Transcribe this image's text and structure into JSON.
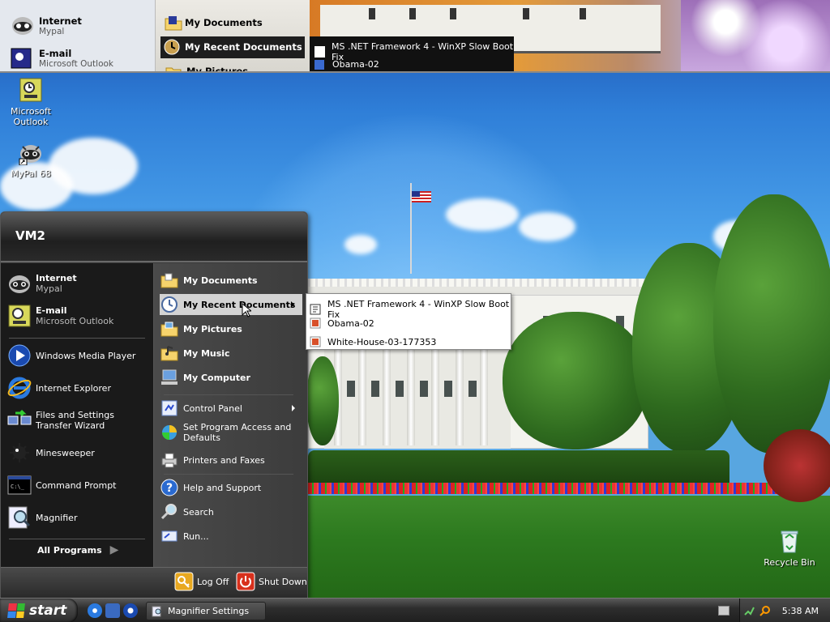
{
  "top_strip": {
    "left": {
      "internet_title": "Internet",
      "internet_sub": "Mypal",
      "email_title": "E-mail",
      "email_sub": "Microsoft Outlook"
    },
    "right": {
      "my_documents": "My Documents",
      "my_recent_documents": "My Recent Documents",
      "my_pictures": "My Pictures"
    },
    "popup": {
      "items": [
        "MS .NET Framework 4 - WinXP Slow Boot Fix",
        "Obama-02"
      ]
    }
  },
  "desktop": {
    "icons": [
      {
        "label_1": "Microsoft",
        "label_2": "Outlook",
        "icon": "outlook-icon"
      },
      {
        "label": "MyPal 68",
        "icon": "mypal-icon"
      },
      {
        "label": "Recycle Bin",
        "icon": "recycle-bin-icon"
      }
    ]
  },
  "start_menu": {
    "user_name": "VM2",
    "left_pinned": [
      {
        "title": "Internet",
        "sub": "Mypal",
        "icon": "mypal-icon"
      },
      {
        "title": "E-mail",
        "sub": "Microsoft Outlook",
        "icon": "outlook-icon"
      }
    ],
    "left_recent": [
      {
        "label": "Windows Media Player",
        "icon": "media-player-icon"
      },
      {
        "label": "Internet Explorer",
        "icon": "internet-explorer-icon"
      },
      {
        "label": "Files and Settings Transfer Wizard",
        "icon": "transfer-wizard-icon"
      },
      {
        "label": "Minesweeper",
        "icon": "minesweeper-icon"
      },
      {
        "label": "Command Prompt",
        "icon": "command-prompt-icon"
      },
      {
        "label": "Magnifier",
        "icon": "magnifier-icon"
      }
    ],
    "all_programs": "All Programs",
    "right_items": [
      {
        "label": "My Documents",
        "icon": "folder-documents-icon"
      },
      {
        "label": "My Recent Documents",
        "icon": "recent-documents-icon",
        "highlighted": true
      },
      {
        "label": "My Pictures",
        "icon": "folder-pictures-icon"
      },
      {
        "label": "My Music",
        "icon": "folder-music-icon"
      },
      {
        "label": "My Computer",
        "icon": "computer-icon"
      },
      {
        "label": "Control Panel",
        "icon": "control-panel-icon"
      },
      {
        "label": "Set Program Access and Defaults",
        "icon": "program-access-icon"
      },
      {
        "label": "Printers and Faxes",
        "icon": "printer-icon"
      },
      {
        "label": "Help and Support",
        "icon": "help-icon"
      },
      {
        "label": "Search",
        "icon": "search-icon"
      },
      {
        "label": "Run...",
        "icon": "run-icon"
      }
    ],
    "footer": {
      "log_off": "Log Off",
      "shut_down": "Shut Down"
    }
  },
  "recent_documents_popup": {
    "items": [
      "MS .NET Framework 4 - WinXP Slow Boot Fix",
      "Obama-02",
      "White-House-03-177353"
    ]
  },
  "taskbar": {
    "start_label": "start",
    "task_buttons": [
      {
        "label": "Magnifier Settings",
        "icon": "magnifier-icon"
      }
    ],
    "clock": "5:38 AM"
  },
  "colors": {
    "menu_dark": "#1a1a1a",
    "menu_mid": "#3c3c3c",
    "highlight": "#d3d3d3",
    "sky_top": "#1b4fae",
    "lawn": "#2d7a1f"
  }
}
